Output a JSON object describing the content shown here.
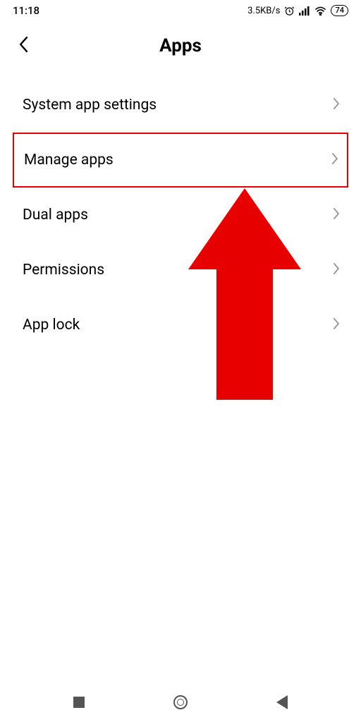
{
  "status": {
    "time": "11:18",
    "speed": "3.5KB/s",
    "battery": "74"
  },
  "header": {
    "title": "Apps"
  },
  "items": [
    {
      "label": "System app settings",
      "highlighted": false
    },
    {
      "label": "Manage apps",
      "highlighted": true
    },
    {
      "label": "Dual apps",
      "highlighted": false
    },
    {
      "label": "Permissions",
      "highlighted": false
    },
    {
      "label": "App lock",
      "highlighted": false
    }
  ],
  "annotation": {
    "arrow_color": "#e60000"
  }
}
